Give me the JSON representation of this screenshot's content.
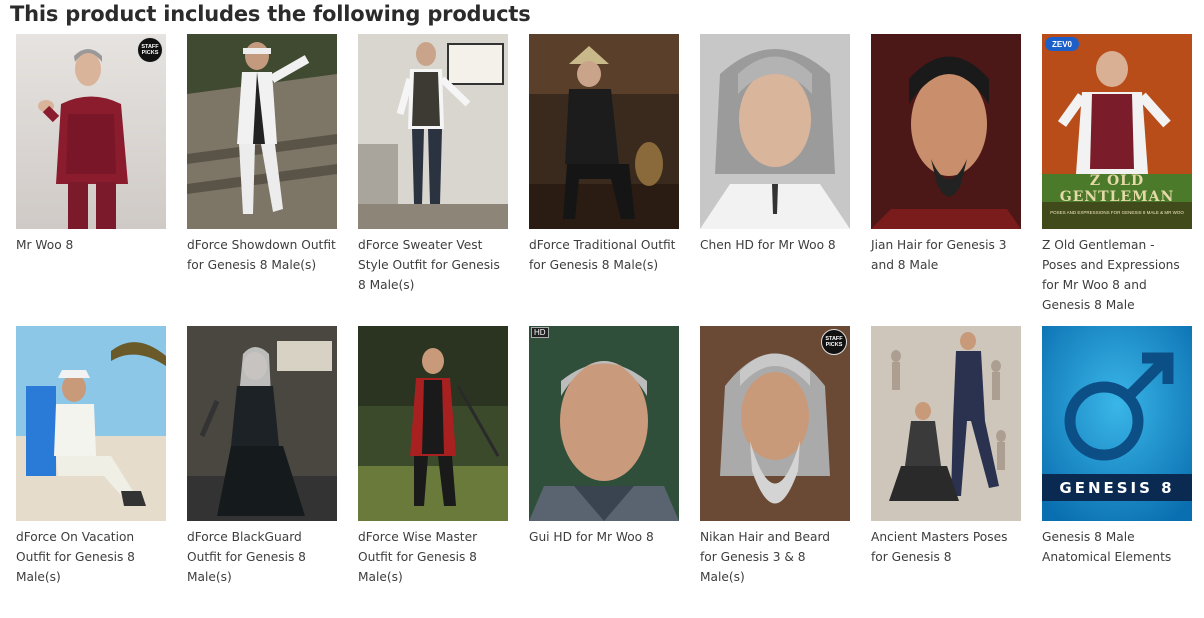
{
  "section": {
    "heading": "This product includes the following products"
  },
  "products": [
    {
      "title": "Mr Woo 8",
      "badge": "STAFF PICKS"
    },
    {
      "title": "dForce Showdown Outfit for Genesis 8 Male(s)"
    },
    {
      "title": "dForce Sweater Vest Style Outfit for Genesis 8 Male(s)"
    },
    {
      "title": "dForce Traditional Outfit for Genesis 8 Male(s)"
    },
    {
      "title": "Chen HD for Mr Woo 8"
    },
    {
      "title": "Jian Hair for Genesis 3 and 8 Male"
    },
    {
      "title": "Z Old Gentleman - Poses and Expressions for Mr Woo 8 and Genesis 8 Male",
      "logo": "ZEV0",
      "caption": "Z OLD GENTLEMAN",
      "subcaption": "POSES AND EXPRESSIONS FOR GENESIS 8 MALE & MR WOO"
    },
    {
      "title": "dForce On Vacation Outfit for Genesis 8 Male(s)"
    },
    {
      "title": "dForce BlackGuard Outfit for Genesis 8 Male(s)"
    },
    {
      "title": "dForce Wise Master Outfit for Genesis 8 Male(s)"
    },
    {
      "title": "Gui HD for Mr Woo 8",
      "badge": "HD"
    },
    {
      "title": "Nikan Hair and Beard for Genesis 3 & 8 Male(s)",
      "badge": "STAFF PICKS"
    },
    {
      "title": "Ancient Masters Poses for Genesis 8"
    },
    {
      "title": "Genesis 8 Male Anatomical Elements",
      "caption": "GENESIS 8"
    }
  ]
}
